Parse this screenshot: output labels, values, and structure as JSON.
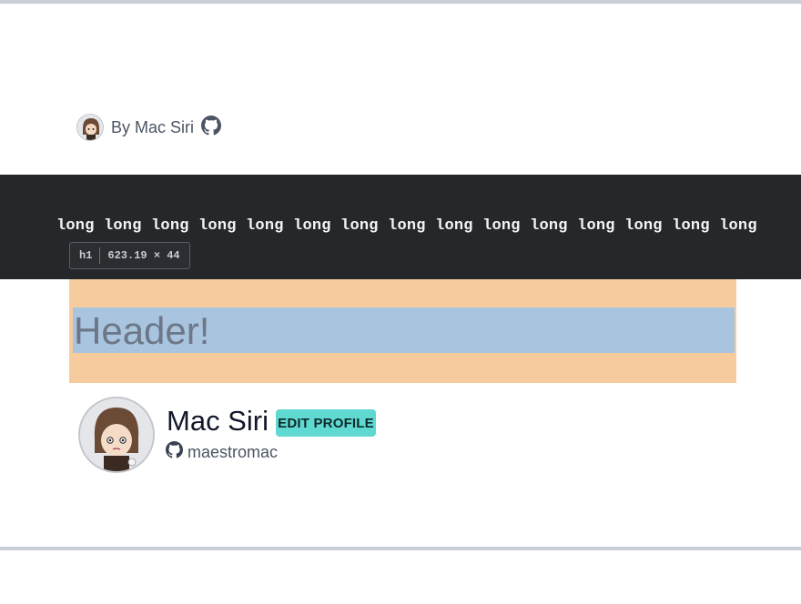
{
  "byline": {
    "text": "By Mac Siri",
    "avatar_icon": "author-avatar",
    "github_icon": "github-icon"
  },
  "code_block": {
    "text": "long long long long long long long long long long long long long long long"
  },
  "devtools_tag": {
    "element": "h1",
    "dimensions": "623.19 × 44"
  },
  "header": {
    "title": "Header!"
  },
  "profile": {
    "name": "Mac Siri",
    "edit_button": "EDIT PROFILE",
    "handle": "maestromac",
    "avatar_icon": "profile-avatar",
    "github_icon": "github-icon"
  },
  "colors": {
    "code_bg": "#26272b",
    "margin_highlight": "#f6cc9e",
    "content_highlight": "#a9c4df",
    "button_accent": "#5fd9d2"
  }
}
